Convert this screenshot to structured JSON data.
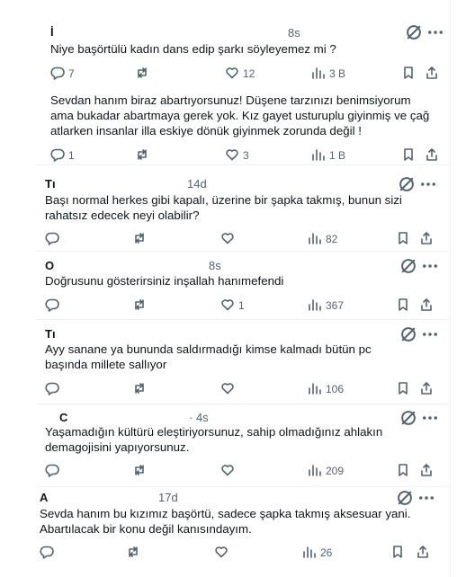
{
  "replies": [
    {
      "name": "İ",
      "time": "8s",
      "text": "Niye başörtülü kadın dans edip şarkı söyleyemez mi ?",
      "replies": "7",
      "reposts": "",
      "likes": "12",
      "views": "3 B"
    },
    {
      "name": "",
      "time": "",
      "text": "Sevdan hanım biraz abartıyorsunuz! Düşene tarzınızı benimsiyorum ama bukadar abartmaya gerek yok. Kız gayet usturuplu giyinmiş ve çağ atlarken insanlar illa eskiye dönük giyinmek zorunda değil !",
      "replies": "1",
      "reposts": "",
      "likes": "3",
      "views": "1 B"
    },
    {
      "name": "Tı",
      "time": "14d",
      "text": "Başı normal herkes gibi kapalı, üzerine bir şapka takmış, bunun sizi rahatsız edecek neyi olabilir?",
      "replies": "",
      "reposts": "",
      "likes": "",
      "views": "82"
    },
    {
      "name": "O",
      "time": "8s",
      "text": "Doğrusunu gösterirsiniz inşallah hanımefendi",
      "replies": "",
      "reposts": "",
      "likes": "1",
      "views": "367"
    },
    {
      "name": "Tı",
      "time": "",
      "text": "Ayy sanane ya bununda saldırmadığı kimse kalmadı bütün pc başında millete sallıyor",
      "replies": "",
      "reposts": "",
      "likes": "",
      "views": "106"
    },
    {
      "name": "C",
      "time": "· 4s",
      "text": "Yaşamadığın kültürü eleştiriyorsunuz, sahip olmadığınız ahlakın demagojisini yapıyorsunuz.",
      "replies": "",
      "reposts": "",
      "likes": "",
      "views": "209"
    },
    {
      "name": "A",
      "time": "17d",
      "text": "Sevda hanım bu kızımız  başörtü, sadece şapka takmış aksesuar yani. Abartılacak bir  konu değil kanısındayım.",
      "replies": "",
      "reposts": "",
      "likes": "",
      "views": "26"
    }
  ],
  "icons": {
    "reply": "reply-icon",
    "repost": "repost-icon",
    "like": "like-icon",
    "views": "views-icon",
    "bookmark": "bookmark-icon",
    "share": "share-icon",
    "grok": "grok-icon",
    "more": "more-icon"
  }
}
